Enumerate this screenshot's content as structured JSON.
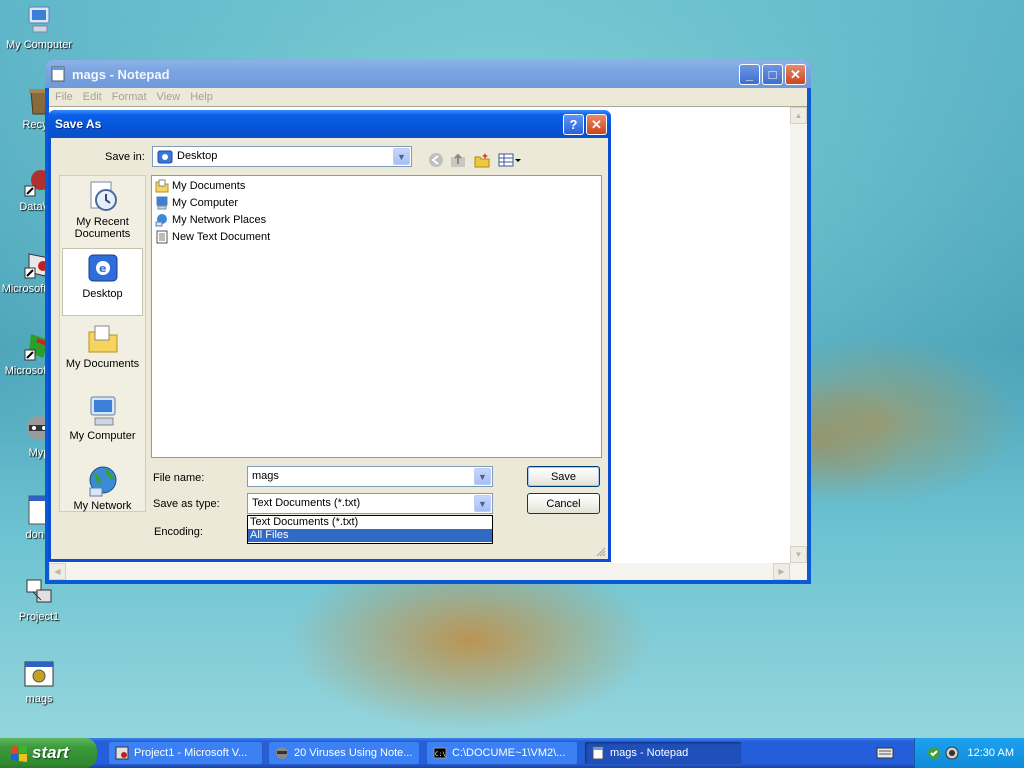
{
  "desktop": {
    "icons": [
      {
        "label": "My Computer"
      },
      {
        "label": "Recycl"
      },
      {
        "label": "DataWa"
      },
      {
        "label": "Microsoft Basic"
      },
      {
        "label": "Microsoft C++"
      },
      {
        "label": "Myp"
      },
      {
        "label": "don c"
      },
      {
        "label": "Project1"
      },
      {
        "label": "mags"
      }
    ]
  },
  "notepad": {
    "title": "mags - Notepad",
    "menu": [
      "File",
      "Edit",
      "Format",
      "View",
      "Help"
    ]
  },
  "dialog": {
    "title": "Save As",
    "save_in_label": "Save in:",
    "save_in_value": "Desktop",
    "places": [
      "My Recent Documents",
      "Desktop",
      "My Documents",
      "My Computer",
      "My Network"
    ],
    "files": [
      "My Documents",
      "My Computer",
      "My Network Places",
      "New Text Document"
    ],
    "file_name_label": "File name:",
    "file_name_value": "mags",
    "save_as_type_label": "Save as type:",
    "save_as_type_value": "Text Documents (*.txt)",
    "encoding_label": "Encoding:",
    "type_options": [
      "Text Documents (*.txt)",
      "All Files"
    ],
    "save_button": "Save",
    "cancel_button": "Cancel"
  },
  "taskbar": {
    "start_label": "start",
    "tasks": [
      "Project1 - Microsoft V...",
      "20 Viruses Using Note...",
      "C:\\DOCUME~1\\VM2\\...",
      "mags - Notepad"
    ],
    "clock": "12:30 AM"
  },
  "colors": {
    "dialog_title": "#0a4fd1",
    "selection": "#316ac5",
    "taskbar": "#245edb",
    "start_button": "#3c9b3c"
  }
}
